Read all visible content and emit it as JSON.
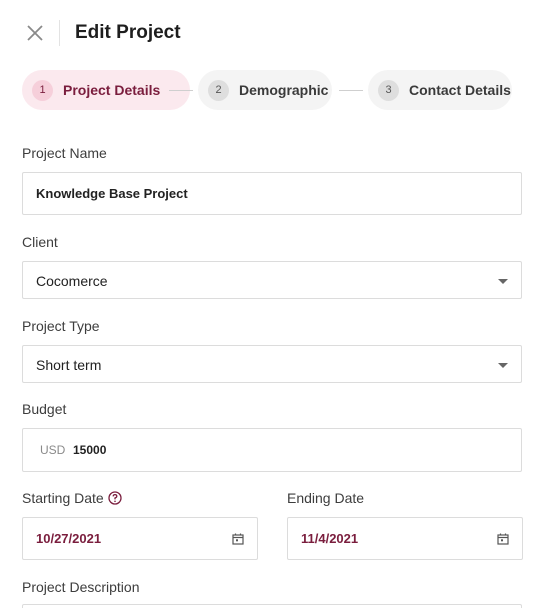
{
  "header": {
    "close_icon": "close-icon",
    "title": "Edit Project"
  },
  "steps": [
    {
      "number": "1",
      "label": "Project Details",
      "active": true
    },
    {
      "number": "2",
      "label": "Demographic",
      "active": false
    },
    {
      "number": "3",
      "label": "Contact Details",
      "active": false
    }
  ],
  "form": {
    "project_name": {
      "label": "Project Name",
      "value": "Knowledge Base Project"
    },
    "client": {
      "label": "Client",
      "value": "Cocomerce"
    },
    "project_type": {
      "label": "Project Type",
      "value": "Short term"
    },
    "budget": {
      "label": "Budget",
      "currency": "USD",
      "value": "15000"
    },
    "starting_date": {
      "label": "Starting Date",
      "value": "10/27/2021",
      "help_icon": "help-icon"
    },
    "ending_date": {
      "label": "Ending Date",
      "value": "11/4/2021"
    },
    "project_description": {
      "label": "Project Description"
    }
  },
  "colors": {
    "accent": "#7a1d3d",
    "active_step_bg": "#fbe9ee",
    "inactive_step_bg": "#f4f4f4",
    "border": "#dcdcdc"
  }
}
